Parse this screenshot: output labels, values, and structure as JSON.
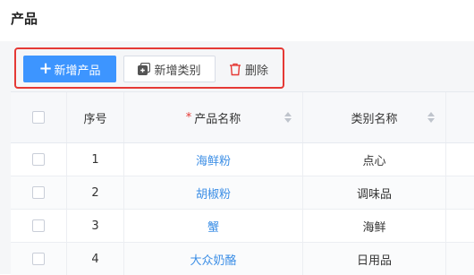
{
  "page": {
    "title": "产品"
  },
  "toolbar": {
    "add_product_label": "新增产品",
    "add_category_label": "新增类别",
    "delete_label": "删除",
    "highlight_color": "#e53935"
  },
  "table": {
    "columns": {
      "index": "序号",
      "required_mark": "*",
      "name": "产品名称",
      "category": "类别名称"
    },
    "rows": [
      {
        "index": "1",
        "name": "海鲜粉",
        "category": "点心"
      },
      {
        "index": "2",
        "name": "胡椒粉",
        "category": "调味品"
      },
      {
        "index": "3",
        "name": "蟹",
        "category": "海鲜"
      },
      {
        "index": "4",
        "name": "大众奶酪",
        "category": "日用品"
      }
    ]
  },
  "colors": {
    "primary": "#3d95ff",
    "link": "#3d8fe6",
    "danger": "#e53935"
  }
}
